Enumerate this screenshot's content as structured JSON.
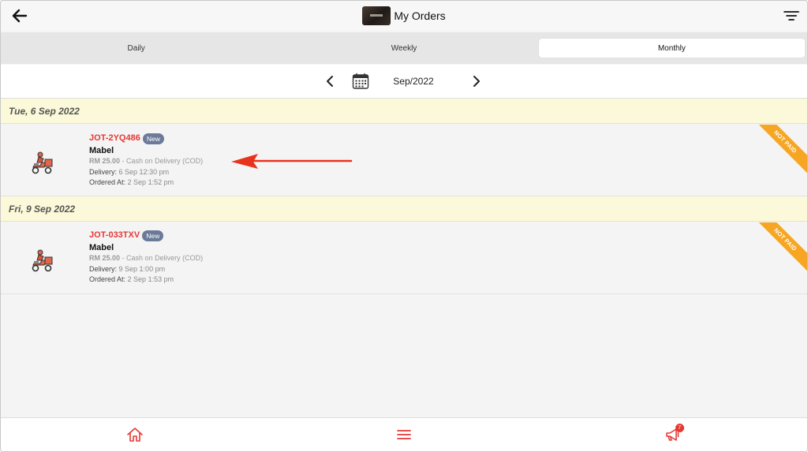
{
  "header": {
    "title": "My Orders",
    "back_icon": "arrow-left-icon",
    "filter_icon": "filter-lines-icon"
  },
  "tabs": [
    {
      "label": "Daily",
      "active": false
    },
    {
      "label": "Weekly",
      "active": false
    },
    {
      "label": "Monthly",
      "active": true
    }
  ],
  "month_nav": {
    "label": "Sep/2022",
    "prev_icon": "chevron-left-icon",
    "next_icon": "chevron-right-icon",
    "calendar_icon": "calendar-icon"
  },
  "groups": [
    {
      "date": "Tue, 6 Sep 2022",
      "order": {
        "id": "JOT-2YQ486",
        "status": "New",
        "customer": "Mabel",
        "amount": "RM 25.00",
        "payment": "- Cash on Delivery (COD)",
        "delivery_label": "Delivery:",
        "delivery": "6 Sep 12:30 pm",
        "ordered_label": "Ordered At:",
        "ordered": "2 Sep 1:52 pm",
        "ribbon": "NOT PAID"
      }
    },
    {
      "date": "Fri, 9 Sep 2022",
      "order": {
        "id": "JOT-033TXV",
        "status": "New",
        "customer": "Mabel",
        "amount": "RM 25.00",
        "payment": "- Cash on Delivery (COD)",
        "delivery_label": "Delivery:",
        "delivery": "9 Sep 1:00 pm",
        "ordered_label": "Ordered At:",
        "ordered": "2 Sep 1:53 pm",
        "ribbon": "NOT PAID"
      }
    }
  ],
  "bottom_nav": {
    "home_icon": "home-icon",
    "menu_icon": "menu-icon",
    "announce_icon": "megaphone-icon",
    "notification_count": "7"
  },
  "colors": {
    "accent": "#e53935",
    "ribbon": "#f6a623",
    "date_bg": "#fbf9d9",
    "badge": "#6b7a99"
  }
}
